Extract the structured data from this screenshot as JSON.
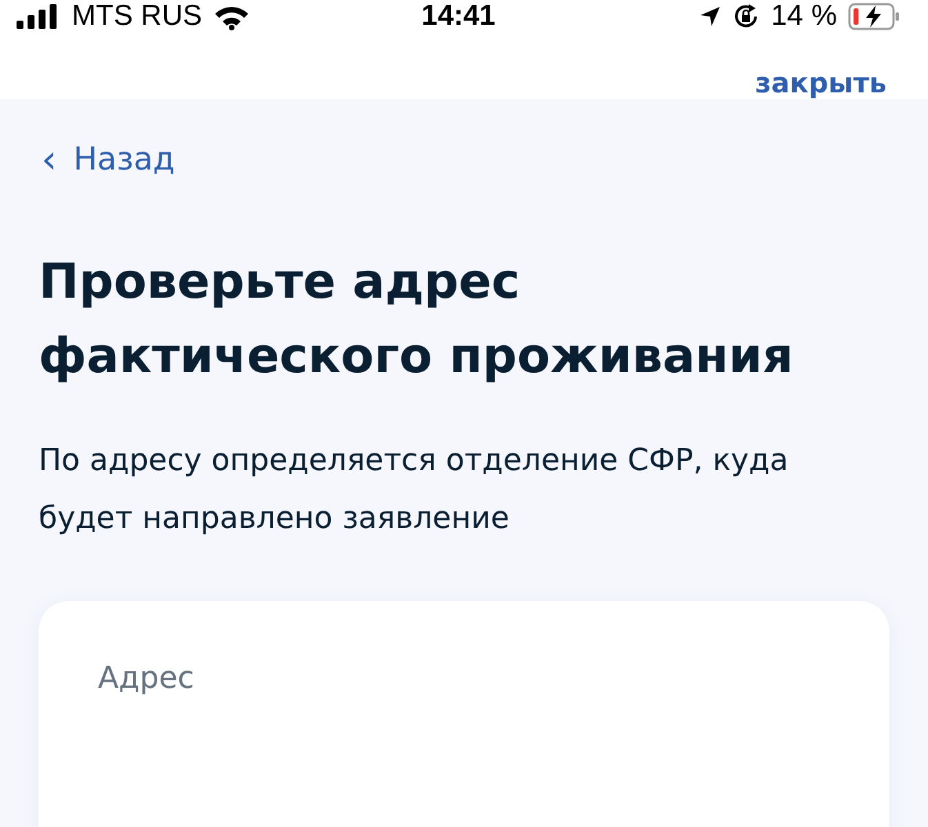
{
  "status_bar": {
    "carrier": "MTS RUS",
    "time": "14:41",
    "battery": "14 %",
    "battery_icon": {
      "level": 0.14
    }
  },
  "header": {
    "close": "закрыть"
  },
  "back": {
    "icon": "‹",
    "label": "Назад"
  },
  "title": "Проверьте адрес фактического проживания",
  "description": "По адресу определяется отделение СФР, куда будет направлено заявление",
  "card": {
    "label": "Адрес"
  }
}
